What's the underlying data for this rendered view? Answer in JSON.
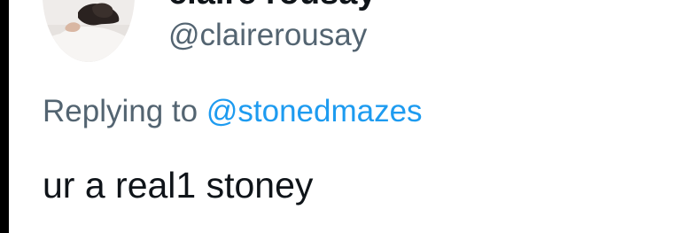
{
  "tweet": {
    "author": {
      "display_name": "claire rousay",
      "handle": "@clairerousay"
    },
    "replying_to": {
      "prefix": "Replying to",
      "mention": "@stonedmazes"
    },
    "text": "ur a real1 stoney"
  },
  "colors": {
    "text_primary": "#0f1419",
    "text_secondary": "#536471",
    "link": "#1d9bf0"
  }
}
